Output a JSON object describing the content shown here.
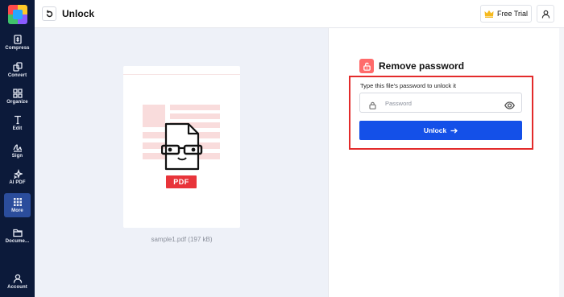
{
  "header": {
    "title": "Unlock",
    "trial_label": "Free Trial"
  },
  "sidebar": {
    "items": [
      {
        "label": "Compress",
        "icon": "compress-icon"
      },
      {
        "label": "Convert",
        "icon": "convert-icon"
      },
      {
        "label": "Organize",
        "icon": "organize-icon"
      },
      {
        "label": "Edit",
        "icon": "edit-icon"
      },
      {
        "label": "Sign",
        "icon": "sign-icon"
      },
      {
        "label": "AI PDF",
        "icon": "ai-sparkle-icon"
      },
      {
        "label": "More",
        "icon": "grid-icon",
        "active": true
      },
      {
        "label": "Docume...",
        "icon": "folder-icon"
      },
      {
        "label": "Account",
        "icon": "account-icon"
      }
    ]
  },
  "preview": {
    "badge": "PDF",
    "filename": "sample1.pdf (197 kB)"
  },
  "panel": {
    "title": "Remove password",
    "hint": "Type this file's password to unlock it",
    "password_placeholder": "Password",
    "password_value": "",
    "unlock_label": "Unlock"
  },
  "colors": {
    "sidebar_bg": "#0c1a3a",
    "primary": "#1450e8",
    "accent_red": "#e8343a",
    "highlight": "#e32b2b",
    "preview_bg": "#eef1f8"
  }
}
